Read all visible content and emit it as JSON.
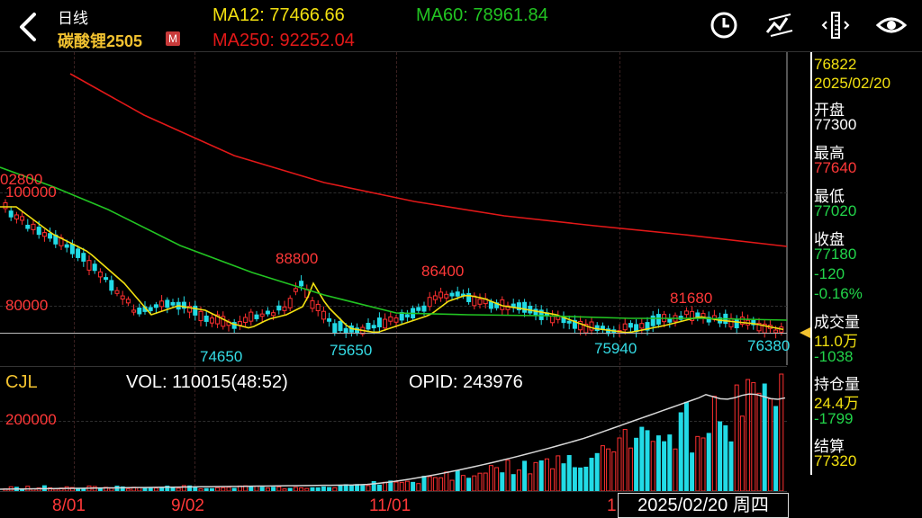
{
  "header": {
    "period": "日线",
    "symbol": "碳酸锂2505",
    "badge": "M",
    "ma12": "MA12: 77466.66",
    "ma60": "MA60: 78961.84",
    "ma250": "MA250: 92252.04"
  },
  "toolbar": {
    "icons": [
      "clock-icon",
      "draw-line-icon",
      "crosshair-ruler-icon",
      "eye-icon"
    ]
  },
  "main_chart": {
    "y_labels": [
      "100000",
      "80000"
    ],
    "top_left_label": "02800",
    "annotations": {
      "high1": "88800",
      "high2": "86400",
      "high3": "81680",
      "low1": "74650",
      "low2": "75650",
      "low3": "75940",
      "low4": "76380"
    },
    "last_price_line": "76822"
  },
  "sub_chart": {
    "indicator": "CJL",
    "vol": "VOL: 110015(48:52)",
    "opid": "OPID: 243976",
    "y_label": "200000"
  },
  "x_axis": {
    "labels": [
      "8/01",
      "9/02",
      "11/01",
      "1"
    ],
    "selected_date": "2025/02/20 周四"
  },
  "side_panel": {
    "price": "76822",
    "date": "2025/02/20",
    "open_label": "开盘",
    "open": "77300",
    "high_label": "最高",
    "high": "77640",
    "low_label": "最低",
    "low": "77020",
    "close_label": "收盘",
    "close": "77180",
    "change": "-120",
    "change_pct": "-0.16%",
    "volume_label": "成交量",
    "volume": "11.0万",
    "volume_change": "-1038",
    "oi_label": "持仓量",
    "oi": "24.4万",
    "oi_change": "-1799",
    "settle_label": "结算",
    "settle": "77320"
  },
  "colors": {
    "up": "#ff3030",
    "down": "#22dbe6",
    "ma12": "#f2e010",
    "ma60": "#22c422",
    "ma250": "#e21818",
    "label_yellow": "#f2c230",
    "label_red": "#ff3838",
    "label_cyan": "#35dce6",
    "oi_line": "#d8d8d8"
  }
}
